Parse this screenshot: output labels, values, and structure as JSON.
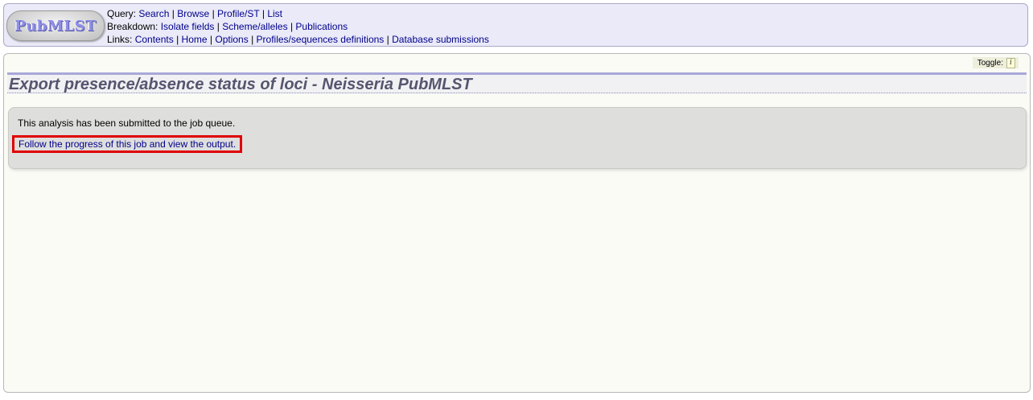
{
  "logo": {
    "text": "PubMLST"
  },
  "nav": {
    "query": {
      "label": "Query:",
      "links": [
        "Search",
        "Browse",
        "Profile/ST",
        "List"
      ]
    },
    "breakdown": {
      "label": "Breakdown:",
      "links": [
        "Isolate fields",
        "Scheme/alleles",
        "Publications"
      ]
    },
    "links": {
      "label": "Links:",
      "links": [
        "Contents",
        "Home",
        "Options",
        "Profiles/sequences definitions",
        "Database submissions"
      ]
    },
    "separator": "|"
  },
  "toggle": {
    "label": "Toggle:",
    "icon": "info-icon",
    "icon_glyph": "i"
  },
  "page": {
    "title": "Export presence/absence status of loci - Neisseria PubMLST",
    "status_text": "This analysis has been submitted to the job queue.",
    "job_link": "Follow the progress of this job and view the output."
  },
  "colors": {
    "link": "#00008b",
    "header_bg": "#eaeaf8",
    "title": "#555570",
    "highlight_border": "#e00000"
  }
}
